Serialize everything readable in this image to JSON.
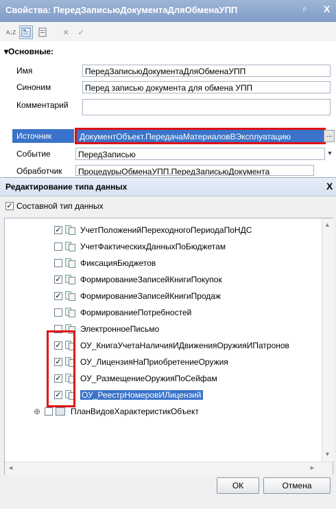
{
  "properties": {
    "title": "Свойства: ПередЗаписьюДокументаДляОбменаУПП",
    "pin_glyph": "ᵖ",
    "close_glyph": "X",
    "toolbar": {
      "sort_glyph": "A↓Z",
      "x_glyph": "✕",
      "check_glyph": "✓"
    },
    "section": "▾Основные:",
    "rows": [
      {
        "label": "Имя",
        "value": "ПередЗаписьюДокументаДляОбменаУПП"
      },
      {
        "label": "Синоним",
        "value": "Перед записью документа для обмена УПП"
      },
      {
        "label": "Комментарий",
        "value": ""
      },
      {
        "label": "Источник",
        "value": "ДокументОбъект.ПередачаМатериаловВЭксплуатацию"
      },
      {
        "label": "Событие",
        "value": "ПередЗаписью"
      },
      {
        "label": "Обработчик",
        "value": "ПроцедурыОбменаУПП.ПередЗаписьюДокумента"
      }
    ],
    "source_button": "...",
    "event_arrow": "▾"
  },
  "dialog": {
    "title": "Редактирование типа данных",
    "close_glyph": "X",
    "composite_label": "Составной тип данных",
    "composite_checked": true,
    "tree_items": [
      {
        "label": "УчетПоложенийПереходногоПериодаПоНДС",
        "checked": true
      },
      {
        "label": "УчетФактическихДанныхПоБюджетам",
        "checked": false
      },
      {
        "label": "ФиксацияБюджетов",
        "checked": false
      },
      {
        "label": "ФормированиеЗаписейКнигиПокупок",
        "checked": true
      },
      {
        "label": "ФормированиеЗаписейКнигиПродаж",
        "checked": true
      },
      {
        "label": "ФормированиеПотребностей",
        "checked": false
      },
      {
        "label": "ЭлектронноеПисьмо",
        "checked": false
      },
      {
        "label": "ОУ_КнигаУчетаНаличияИДвиженияОружияИПатронов",
        "checked": true
      },
      {
        "label": "ОУ_ЛицензияНаПриобретениеОружия",
        "checked": true
      },
      {
        "label": "ОУ_РазмещениеОружияПоСейфам",
        "checked": true
      },
      {
        "label": "ОУ_РеестрНомеровИЛицензий",
        "checked": true,
        "selected": true
      }
    ],
    "group_item": {
      "expander": "⊕",
      "label": "ПланВидовХарактеристикОбъект",
      "checked": false
    },
    "check_glyph": "✓",
    "scroll_up": "▲",
    "scroll_down": "▼",
    "scroll_left": "◄",
    "scroll_right": "►",
    "ok_label": "ОК",
    "cancel_label": "Отмена"
  }
}
